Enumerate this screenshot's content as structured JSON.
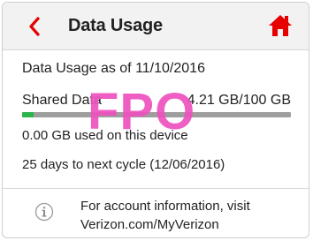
{
  "header": {
    "title": "Data Usage",
    "back_icon": "chevron-left-icon",
    "home_icon": "home-icon",
    "accent_color": "#e60000"
  },
  "usage": {
    "as_of": "Data Usage as of 11/10/2016",
    "shared_label": "Shared Data",
    "shared_value": "4.21 GB/100 GB",
    "progress_fraction": 0.0421,
    "progress_color": "#2cb34a",
    "device_used": "0.00 GB used on this device",
    "cycle": "25 days to next cycle (12/06/2016)"
  },
  "info": {
    "icon": "info-icon",
    "line1": "For account information, visit",
    "line2": "Verizon.com/MyVerizon"
  },
  "watermark": {
    "text": "FPO",
    "color": "#ee50be"
  }
}
